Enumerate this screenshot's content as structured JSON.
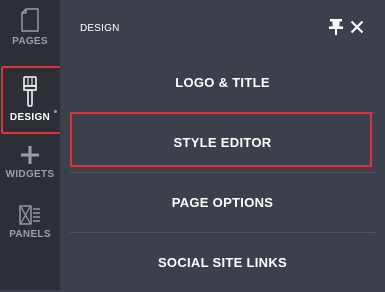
{
  "sidebar": {
    "items": [
      {
        "label": "PAGES",
        "icon": "page-icon"
      },
      {
        "label": "DESIGN",
        "icon": "paintbrush-icon"
      },
      {
        "label": "WIDGETS",
        "icon": "plus-icon"
      },
      {
        "label": "PANELS",
        "icon": "panels-icon"
      }
    ]
  },
  "panel": {
    "title": "DESIGN",
    "menu": [
      {
        "label": "LOGO & TITLE"
      },
      {
        "label": "STYLE EDITOR"
      },
      {
        "label": "PAGE OPTIONS"
      },
      {
        "label": "SOCIAL SITE LINKS"
      }
    ]
  },
  "colors": {
    "rail_bg": "#2c2f36",
    "panel_bg": "#3c404a",
    "highlight": "#e0323c",
    "text": "#ffffff",
    "muted": "#9aa0aa"
  }
}
